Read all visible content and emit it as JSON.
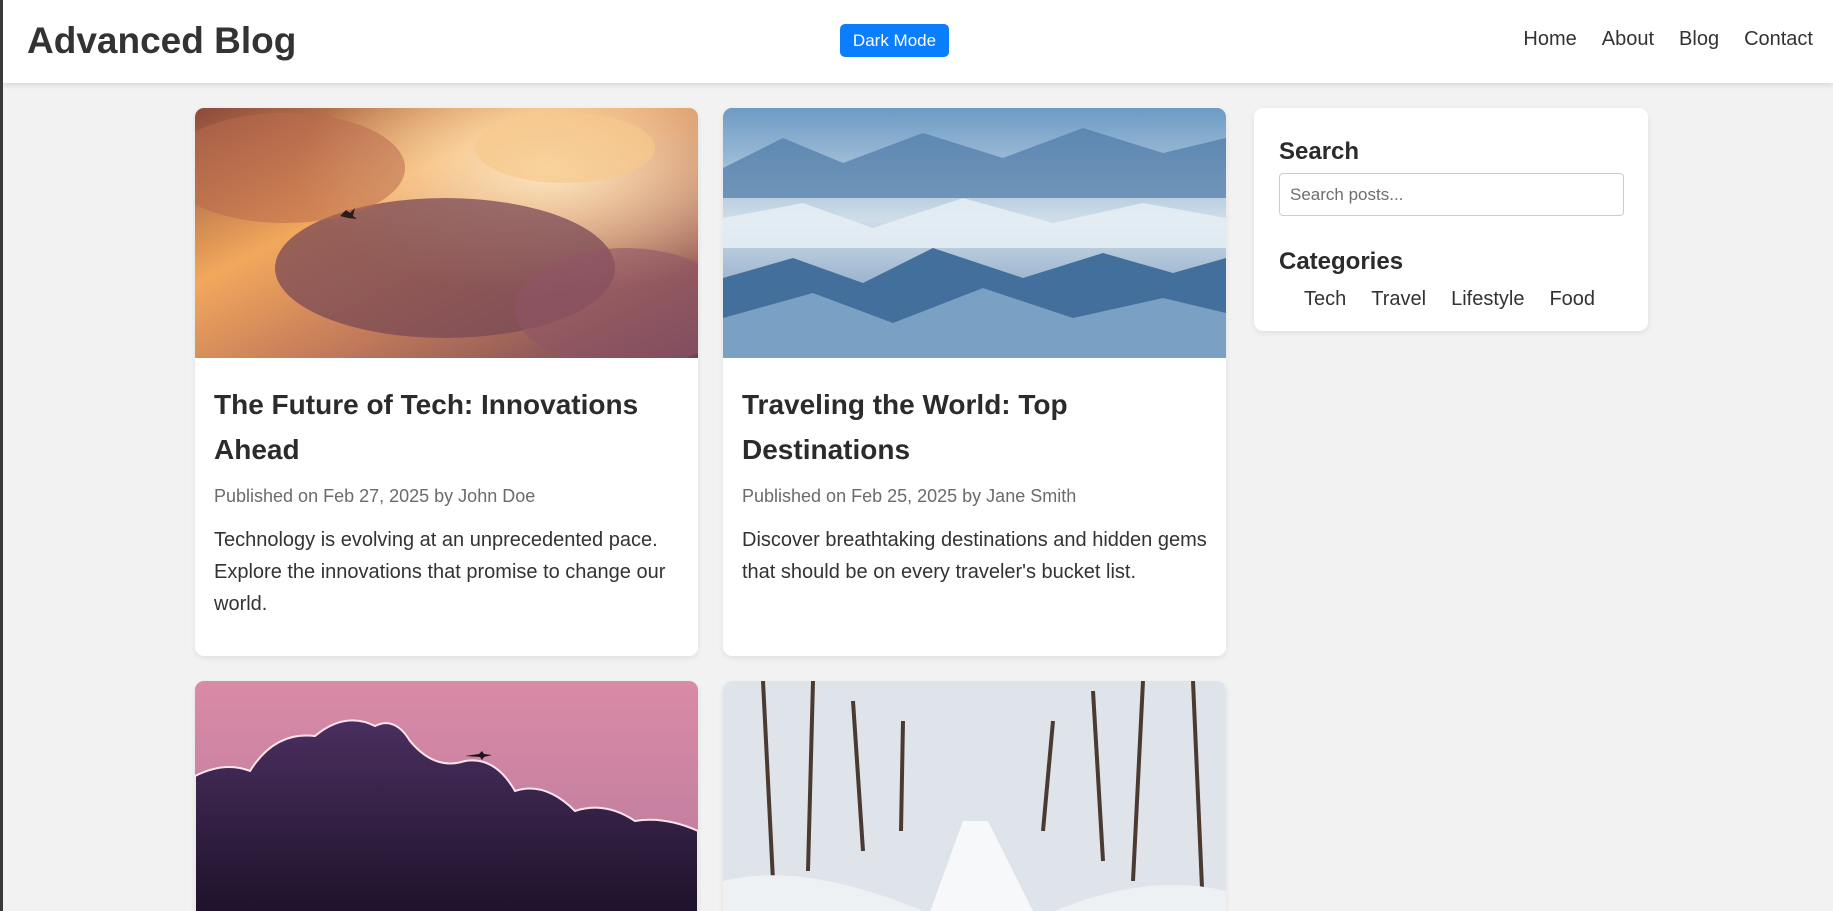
{
  "header": {
    "title": "Advanced Blog",
    "dark_mode_label": "Dark Mode",
    "nav": [
      "Home",
      "About",
      "Blog",
      "Contact"
    ]
  },
  "posts": [
    {
      "title": "The Future of Tech: Innovations Ahead",
      "meta": "Published on Feb 27, 2025 by John Doe",
      "excerpt": "Technology is evolving at an unprecedented pace. Explore the innovations that promise to change our world."
    },
    {
      "title": "Traveling the World: Top Destinations",
      "meta": "Published on Feb 25, 2025 by Jane Smith",
      "excerpt": "Discover breathtaking destinations and hidden gems that should be on every traveler's bucket list."
    },
    {
      "title": "",
      "meta": "",
      "excerpt": ""
    },
    {
      "title": "",
      "meta": "",
      "excerpt": ""
    }
  ],
  "sidebar": {
    "search_heading": "Search",
    "search_placeholder": "Search posts...",
    "categories_heading": "Categories",
    "categories": [
      "Tech",
      "Travel",
      "Lifestyle",
      "Food"
    ]
  },
  "colors": {
    "accent": "#0b7dff",
    "background": "#f2f2f2"
  }
}
